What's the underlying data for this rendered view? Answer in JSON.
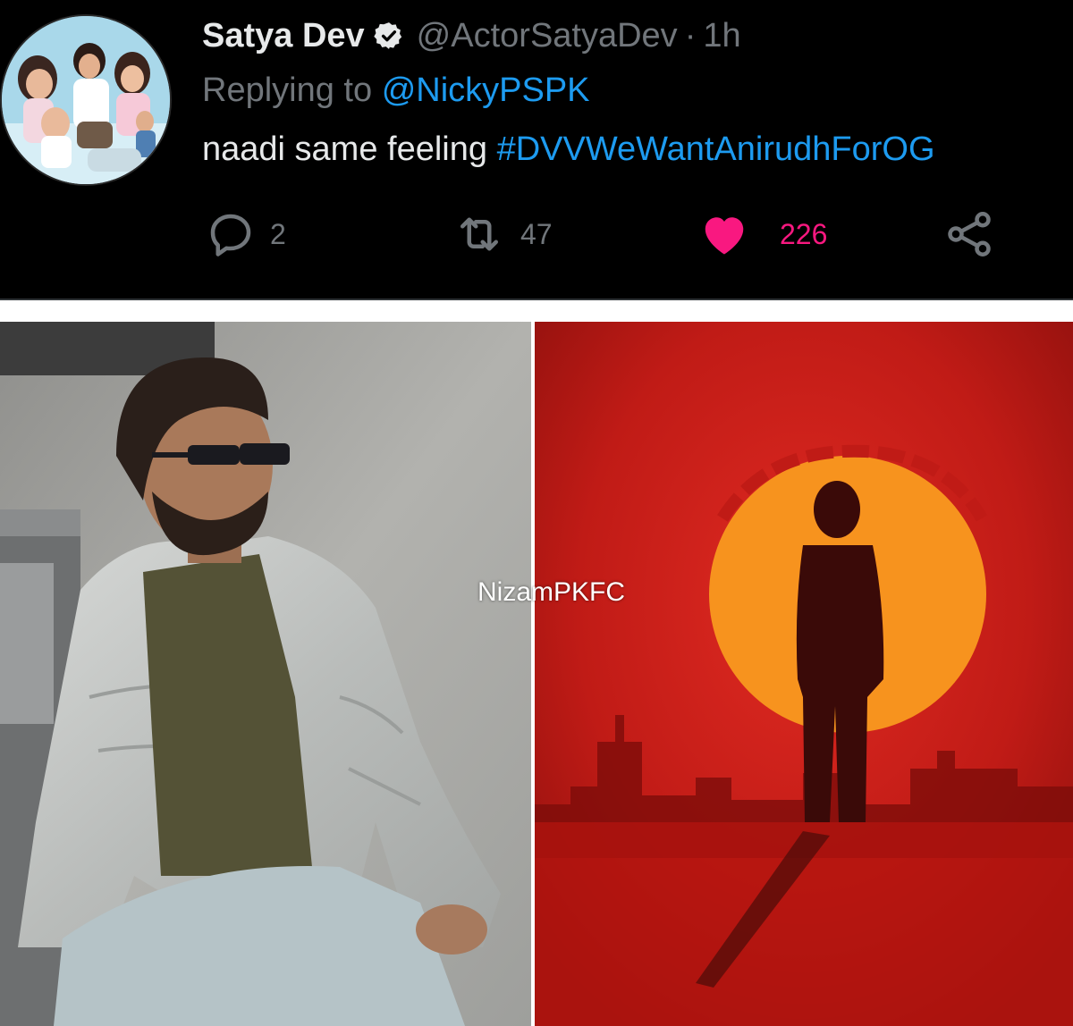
{
  "tweet": {
    "display_name": "Satya Dev",
    "verified_icon": "verified-badge-icon",
    "handle": "@ActorSatyaDev",
    "separator": "·",
    "timestamp": "1h",
    "replying_prefix": "Replying to",
    "replying_to": "@NickyPSPK",
    "text": "naadi same feeling",
    "hashtag": "#DVVWeWantAnirudhForOG",
    "actions": {
      "reply_count": "2",
      "retweet_count": "47",
      "like_count": "226",
      "liked": true
    }
  },
  "image": {
    "watermark": "NizamPKFC"
  },
  "colors": {
    "background": "#000000",
    "primary_text": "#e7e9ea",
    "secondary_text": "#71767b",
    "link": "#1d9bf0",
    "like": "#f91880",
    "poster_red": "#c41a16",
    "poster_sun": "#f7931e"
  }
}
